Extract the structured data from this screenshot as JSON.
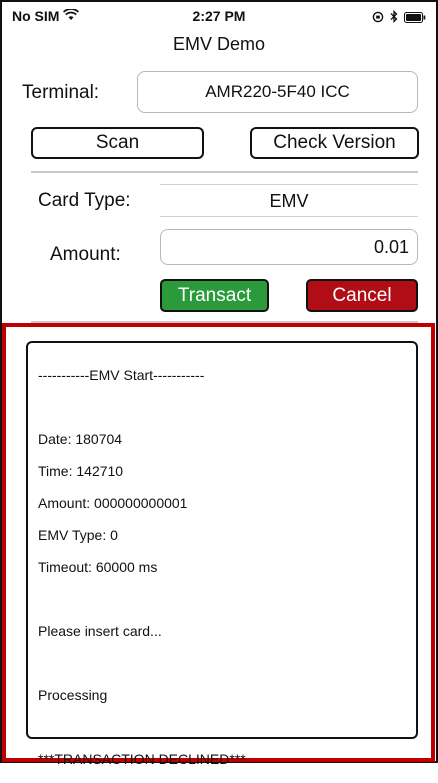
{
  "status_bar": {
    "carrier": "No SIM",
    "time": "2:27 PM"
  },
  "nav": {
    "title": "EMV Demo"
  },
  "terminal": {
    "label": "Terminal:",
    "value": "AMR220-5F40 ICC"
  },
  "buttons": {
    "scan": "Scan",
    "check_version": "Check Version",
    "transact": "Transact",
    "cancel": "Cancel"
  },
  "card_type": {
    "label": "Card Type:",
    "value": "EMV"
  },
  "amount": {
    "label": "Amount:",
    "value": "0.01"
  },
  "colors": {
    "transact_green": "#2a9a3a",
    "cancel_red": "#b10d17",
    "highlight_red": "#c00000"
  },
  "log": {
    "header": "-----------EMV Start-----------",
    "date": "Date: 180704",
    "time": "Time: 142710",
    "amount": "Amount: 000000000001",
    "emv_type": "EMV Type: 0",
    "timeout": "Timeout: 60000 ms",
    "insert": "Please insert card...",
    "processing": "Processing",
    "result": "***TRANSACTION DECLINED***"
  }
}
